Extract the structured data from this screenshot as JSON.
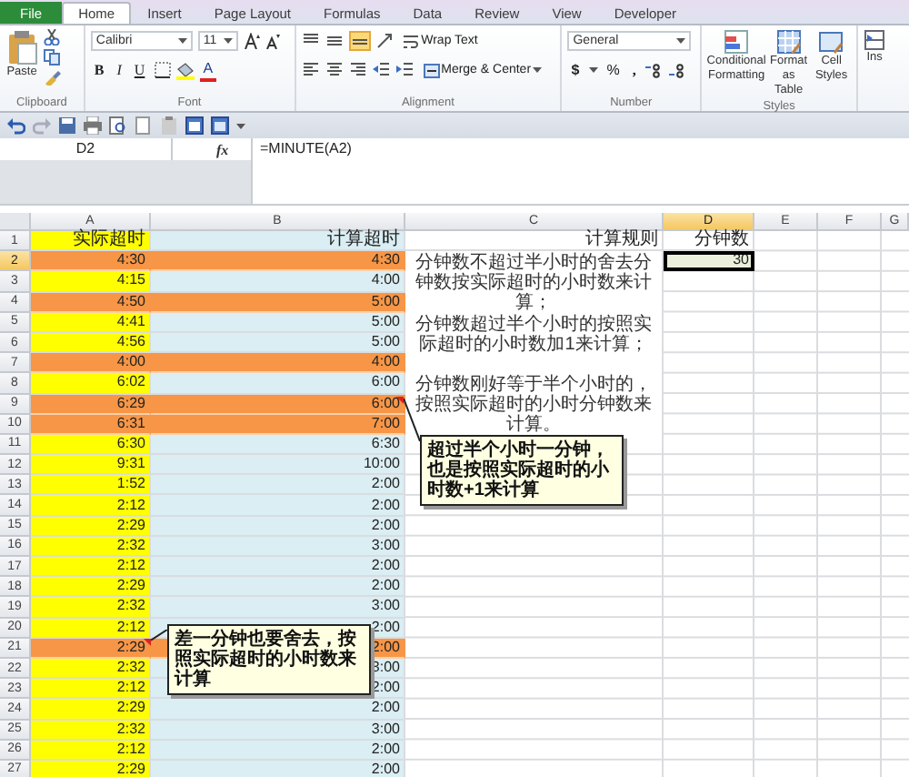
{
  "ribbon_tabs": [
    {
      "label": "File",
      "kind": "file",
      "selected": false
    },
    {
      "label": "Home",
      "kind": "tab",
      "selected": true
    },
    {
      "label": "Insert",
      "kind": "tab",
      "selected": false
    },
    {
      "label": "Page Layout",
      "kind": "tab",
      "selected": false
    },
    {
      "label": "Formulas",
      "kind": "tab",
      "selected": false
    },
    {
      "label": "Data",
      "kind": "tab",
      "selected": false
    },
    {
      "label": "Review",
      "kind": "tab",
      "selected": false
    },
    {
      "label": "View",
      "kind": "tab",
      "selected": false
    },
    {
      "label": "Developer",
      "kind": "tab",
      "selected": false
    }
  ],
  "ribbon": {
    "clipboard": {
      "paste": "Paste",
      "label": "Clipboard"
    },
    "font": {
      "name": "Calibri",
      "size": "11",
      "bold": "B",
      "italic": "I",
      "underline": "U",
      "font_color_button": "A",
      "label": "Font"
    },
    "alignment": {
      "wrap_text": "Wrap Text",
      "merge_center": "Merge & Center",
      "label": "Alignment"
    },
    "number": {
      "format": "General",
      "currency": "$",
      "percent": "%",
      "comma": ",",
      "label": "Number"
    },
    "styles": {
      "buttons": [
        "Conditional Formatting",
        "Format as Table",
        "Cell Styles"
      ],
      "label": "Styles"
    },
    "cells": {
      "insert": "Ins"
    }
  },
  "formula_bar": {
    "name_box": "D2",
    "function_label": "fx",
    "formula": "=MINUTE(A2)"
  },
  "sheet": {
    "columns": [
      {
        "label": "A",
        "selected": false
      },
      {
        "label": "B",
        "selected": false
      },
      {
        "label": "C",
        "selected": false
      },
      {
        "label": "D",
        "selected": true
      },
      {
        "label": "E",
        "selected": false
      },
      {
        "label": "F",
        "selected": false
      },
      {
        "label": "G",
        "selected": false
      }
    ],
    "rows": [
      {
        "number": "1",
        "a": "实际超时",
        "b": "计算超时",
        "c": "计算规则",
        "d": "分钟数",
        "highlighted": false,
        "selected": false
      },
      {
        "number": "2",
        "a": "4:30",
        "b": "4:30",
        "d": "30",
        "highlighted": true,
        "selected": true
      },
      {
        "number": "3",
        "a": "4:15",
        "b": "4:00",
        "highlighted": false,
        "selected": false
      },
      {
        "number": "4",
        "a": "4:50",
        "b": "5:00",
        "highlighted": true,
        "selected": false
      },
      {
        "number": "5",
        "a": "4:41",
        "b": "5:00",
        "highlighted": false,
        "selected": false
      },
      {
        "number": "6",
        "a": "4:56",
        "b": "5:00",
        "highlighted": false,
        "selected": false
      },
      {
        "number": "7",
        "a": "4:00",
        "b": "4:00",
        "highlighted": true,
        "selected": false
      },
      {
        "number": "8",
        "a": "6:02",
        "b": "6:00",
        "highlighted": false,
        "selected": false
      },
      {
        "number": "9",
        "a": "6:29",
        "b": "6:00",
        "highlighted": true,
        "selected": false
      },
      {
        "number": "10",
        "a": "6:31",
        "b": "7:00",
        "highlighted": true,
        "selected": false
      },
      {
        "number": "11",
        "a": "6:30",
        "b": "6:30",
        "highlighted": false,
        "selected": false
      },
      {
        "number": "12",
        "a": "9:31",
        "b": "10:00",
        "highlighted": false,
        "selected": false
      },
      {
        "number": "13",
        "a": "1:52",
        "b": "2:00",
        "highlighted": false,
        "selected": false
      },
      {
        "number": "14",
        "a": "2:12",
        "b": "2:00",
        "highlighted": false,
        "selected": false
      },
      {
        "number": "15",
        "a": "2:29",
        "b": "2:00",
        "highlighted": false,
        "selected": false
      },
      {
        "number": "16",
        "a": "2:32",
        "b": "3:00",
        "highlighted": false,
        "selected": false
      },
      {
        "number": "17",
        "a": "2:12",
        "b": "2:00",
        "highlighted": false,
        "selected": false
      },
      {
        "number": "18",
        "a": "2:29",
        "b": "2:00",
        "highlighted": false,
        "selected": false
      },
      {
        "number": "19",
        "a": "2:32",
        "b": "3:00",
        "highlighted": false,
        "selected": false
      },
      {
        "number": "20",
        "a": "2:12",
        "b": "2:00",
        "highlighted": false,
        "selected": false
      },
      {
        "number": "21",
        "a": "2:29",
        "b": "2:00",
        "highlighted": true,
        "selected": false
      },
      {
        "number": "22",
        "a": "2:32",
        "b": "3:00",
        "highlighted": false,
        "selected": false
      },
      {
        "number": "23",
        "a": "2:12",
        "b": "2:00",
        "highlighted": false,
        "selected": false
      },
      {
        "number": "24",
        "a": "2:29",
        "b": "2:00",
        "highlighted": false,
        "selected": false
      },
      {
        "number": "25",
        "a": "2:32",
        "b": "3:00",
        "highlighted": false,
        "selected": false
      },
      {
        "number": "26",
        "a": "2:12",
        "b": "2:00",
        "highlighted": false,
        "selected": false
      },
      {
        "number": "27",
        "a": "2:29",
        "b": "2:00",
        "highlighted": false,
        "selected": false
      }
    ],
    "notes": [
      "分钟数不超过半小时的舍去分钟数按实际超时的小时数来计算；",
      "分钟数超过半个小时的按照实际超时的小时数加1来计算；",
      "分钟数刚好等于半个小时的，按照实际超时的小时分钟数来计算。"
    ],
    "comments": [
      "超过半个小时一分钟，也是按照实际超时的小时数+1来计算",
      "差一分钟也要舍去，按照实际超时的小时数来计算"
    ]
  }
}
